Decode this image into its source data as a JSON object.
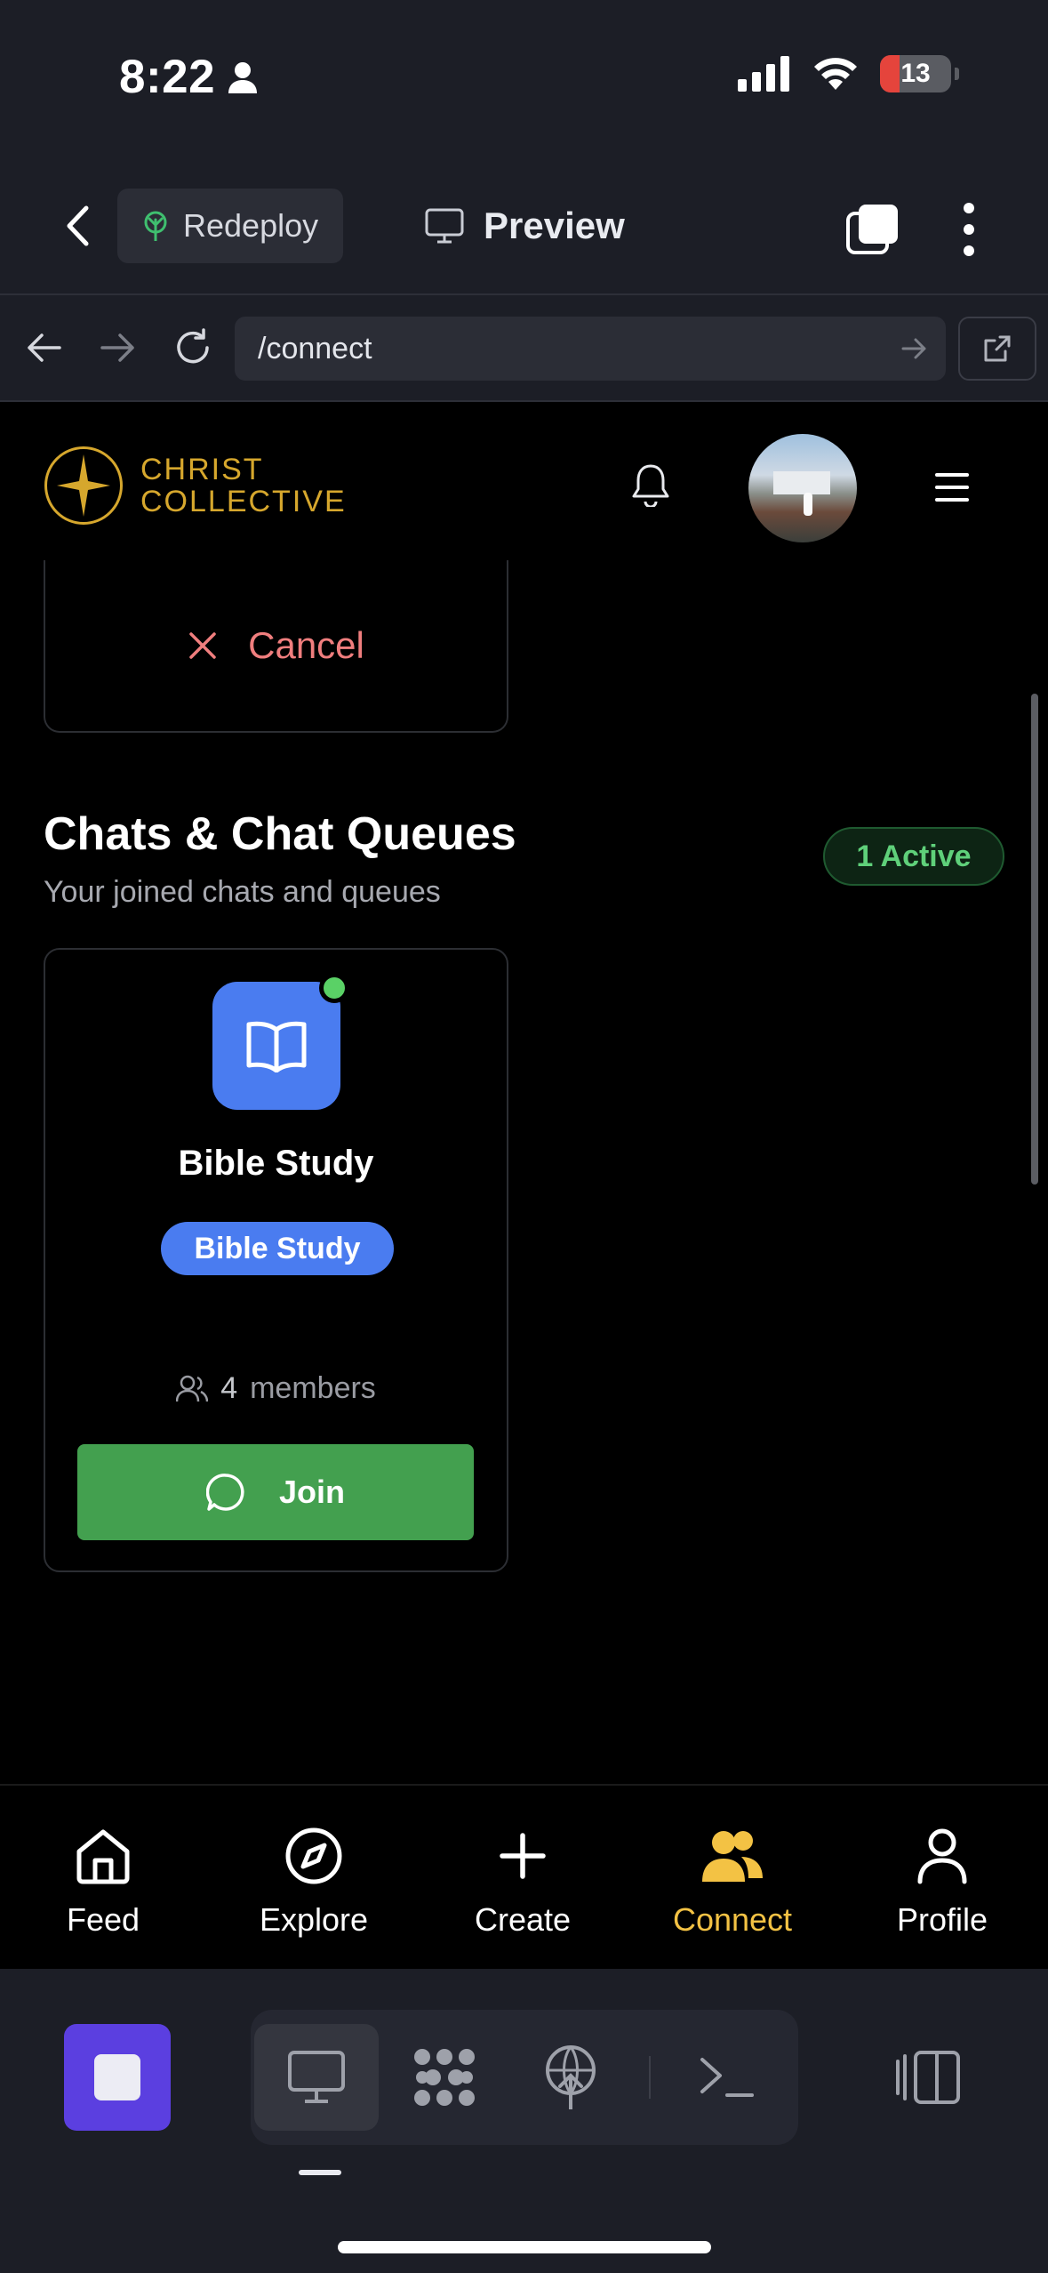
{
  "status_bar": {
    "time": "8:22",
    "battery": "13",
    "battery_color": "#e5443c"
  },
  "app_bar": {
    "redeploy_label": "Redeploy",
    "preview_label": "Preview"
  },
  "url_bar": {
    "url": "/connect"
  },
  "site": {
    "logo_line1": "CHRIST",
    "logo_line2": "COLLECTIVE",
    "brand_color": "#d6a72d"
  },
  "cancel_card": {
    "cancel_label": "Cancel"
  },
  "chats_section": {
    "title": "Chats & Chat Queues",
    "subtitle": "Your joined chats and queues",
    "active_badge": "1 Active",
    "cards": [
      {
        "name": "Bible Study",
        "tag": "Bible Study",
        "members_count": "4",
        "members_label": "members",
        "join_label": "Join",
        "icon": "open-book-icon",
        "accent": "#4a7cf0"
      }
    ]
  },
  "bottom_nav": {
    "items": [
      {
        "label": "Feed",
        "icon": "home-icon"
      },
      {
        "label": "Explore",
        "icon": "compass-icon"
      },
      {
        "label": "Create",
        "icon": "plus-icon"
      },
      {
        "label": "Connect",
        "icon": "users-icon",
        "active": true
      },
      {
        "label": "Profile",
        "icon": "user-icon"
      }
    ],
    "active_color": "#f3c244"
  },
  "dock": {
    "stop_color": "#5b3fe0"
  }
}
